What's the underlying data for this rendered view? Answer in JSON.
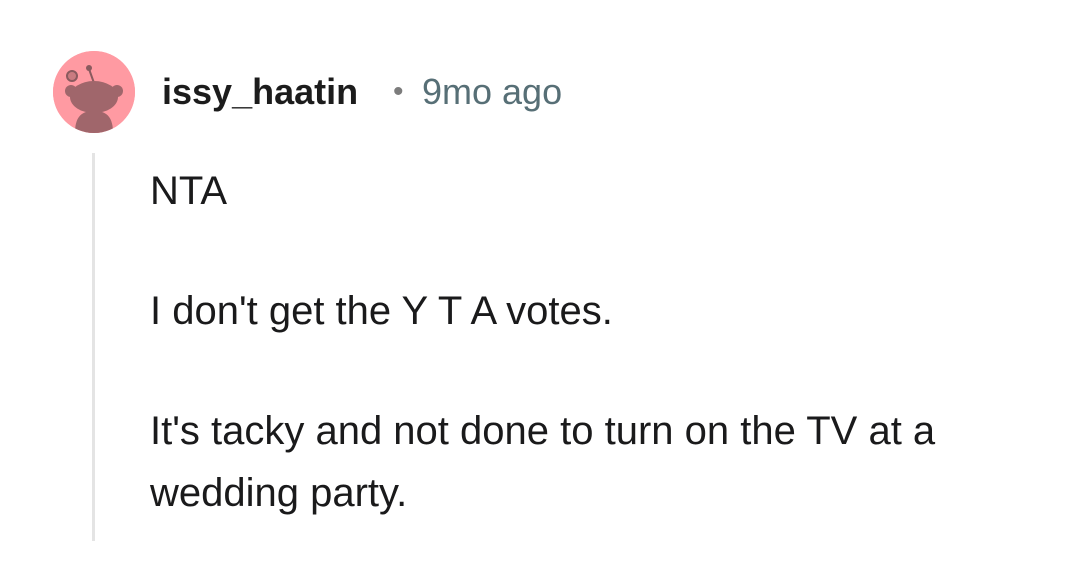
{
  "comment": {
    "author": "issy_haatin",
    "separator": "•",
    "time": "9mo ago",
    "paragraphs": [
      "NTA",
      "I don't get the Y T A votes.",
      "It's tacky and not done to turn on the TV at a wedding party."
    ],
    "avatar_icon": "snoo-avatar-icon",
    "avatar_color": "#ff9aa2"
  }
}
